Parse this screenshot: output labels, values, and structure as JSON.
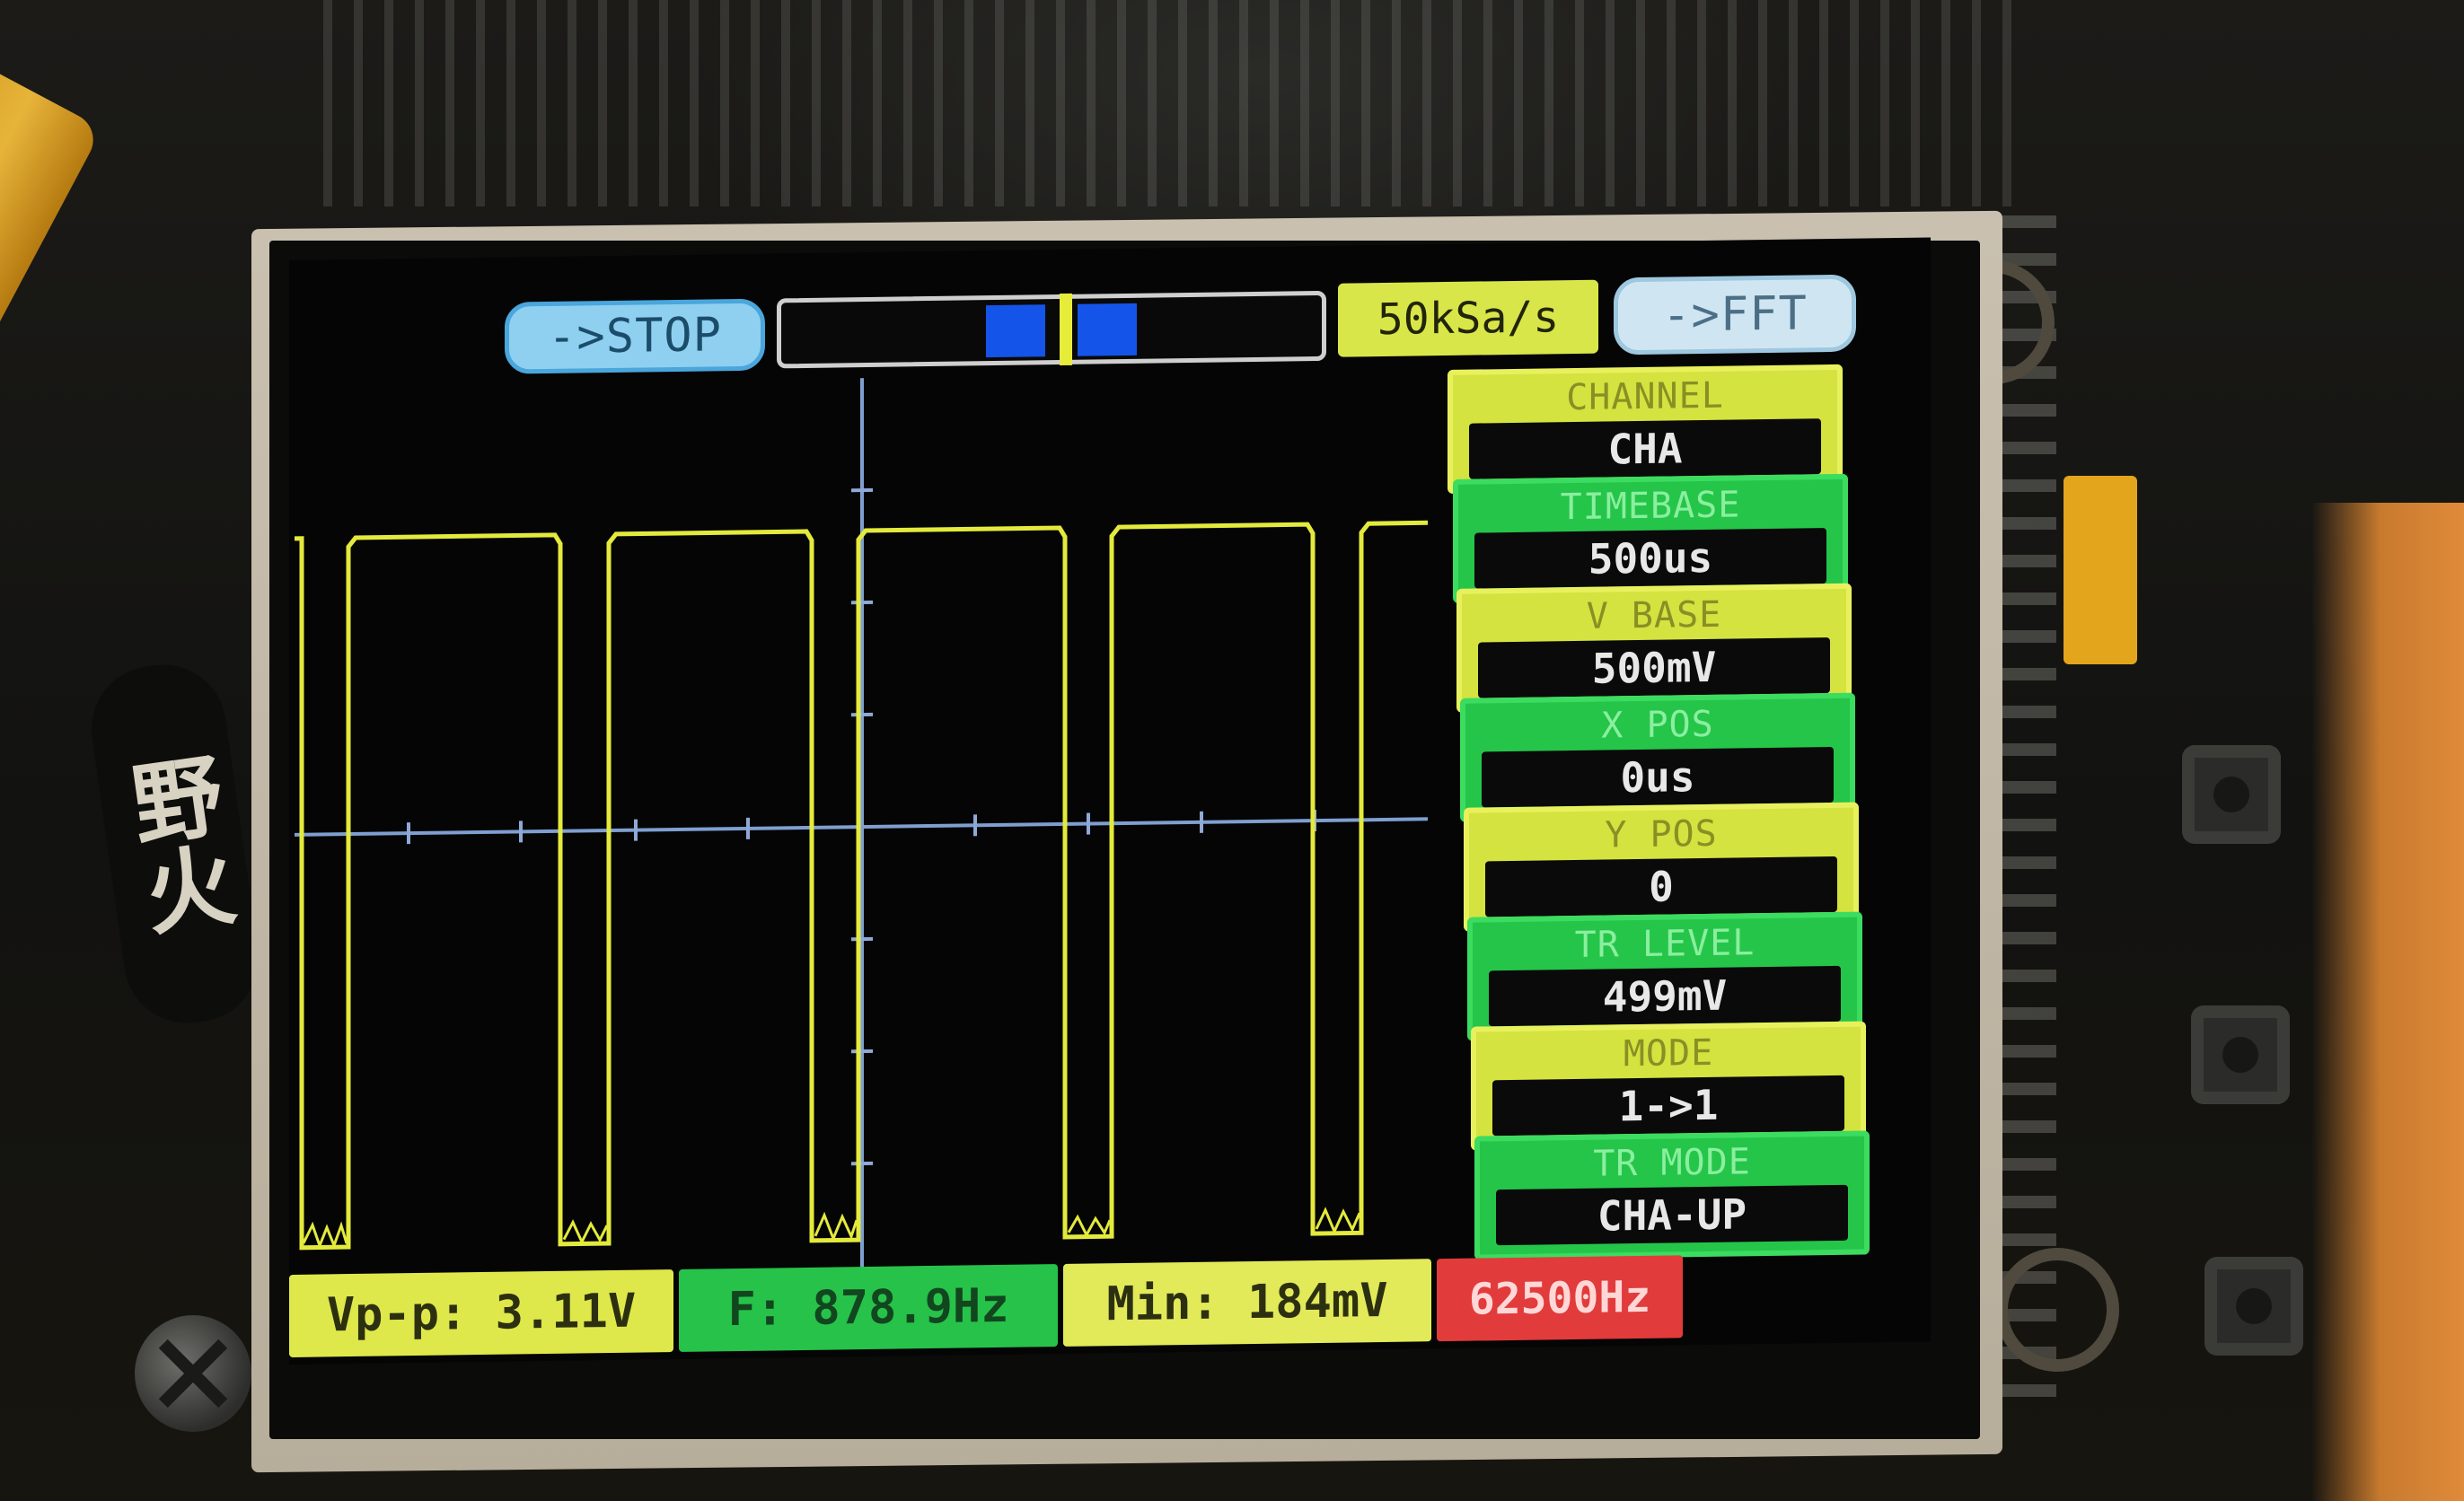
{
  "scope": {
    "stop_button": "->STOP",
    "fft_button": "->FFT",
    "sample_rate": "50kSa/s",
    "colors": {
      "trace": "#e3ea3c",
      "axis": "#7f9fd0",
      "panel_yellow": "#d4e33f",
      "panel_green": "#25c54a",
      "counter_red": "#e23b3b",
      "scroll_thumb": "#1454e8"
    },
    "params": [
      {
        "title": "CHANNEL",
        "value": "CHA",
        "style": "yellow"
      },
      {
        "title": "TIMEBASE",
        "value": "500us",
        "style": "green"
      },
      {
        "title": "V BASE",
        "value": "500mV",
        "style": "yellow"
      },
      {
        "title": "X POS",
        "value": "0us",
        "style": "green"
      },
      {
        "title": "Y POS",
        "value": "0",
        "style": "yellow"
      },
      {
        "title": "TR LEVEL",
        "value": "499mV",
        "style": "green"
      },
      {
        "title": "MODE",
        "value": "1->1",
        "style": "yellow"
      },
      {
        "title": "TR MODE",
        "value": "CHA-UP",
        "style": "green"
      }
    ],
    "measurements": {
      "vpp": "Vp-p: 3.11V",
      "freq": "F: 878.9Hz",
      "min": "Min: 184mV",
      "counter": "62500Hz"
    }
  },
  "board": {
    "label": "野火"
  },
  "icons": [
    "screw-icon",
    "push-button-icon",
    "mounting-ring-icon"
  ]
}
